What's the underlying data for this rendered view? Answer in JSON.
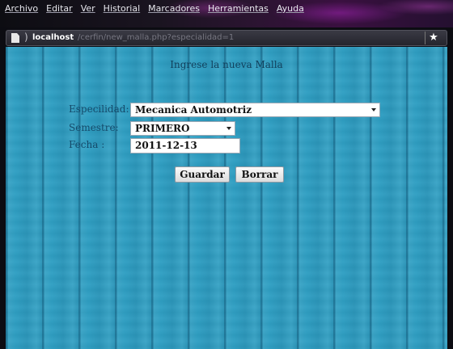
{
  "menu": {
    "items": [
      "Archivo",
      "Editar",
      "Ver",
      "Historial",
      "Marcadores",
      "Herramientas",
      "Ayuda"
    ]
  },
  "address_bar": {
    "host": "localhost",
    "path": "/cerfin/new_malla.php?especialidad=1",
    "separator": ")",
    "bookmark_glyph": "★"
  },
  "form": {
    "title": "Ingrese la nueva Malla",
    "especialidad": {
      "label": "Especilidad:",
      "value": "Mecanica Automotriz"
    },
    "semestre": {
      "label": "Semestre:",
      "value": "PRIMERO"
    },
    "fecha": {
      "label": "Fecha :",
      "value": "2011-12-13"
    },
    "save_label": "Guardar",
    "reset_label": "Borrar"
  },
  "colors": {
    "page_background": "#2f9fc3",
    "label_text": "#154a6a"
  }
}
